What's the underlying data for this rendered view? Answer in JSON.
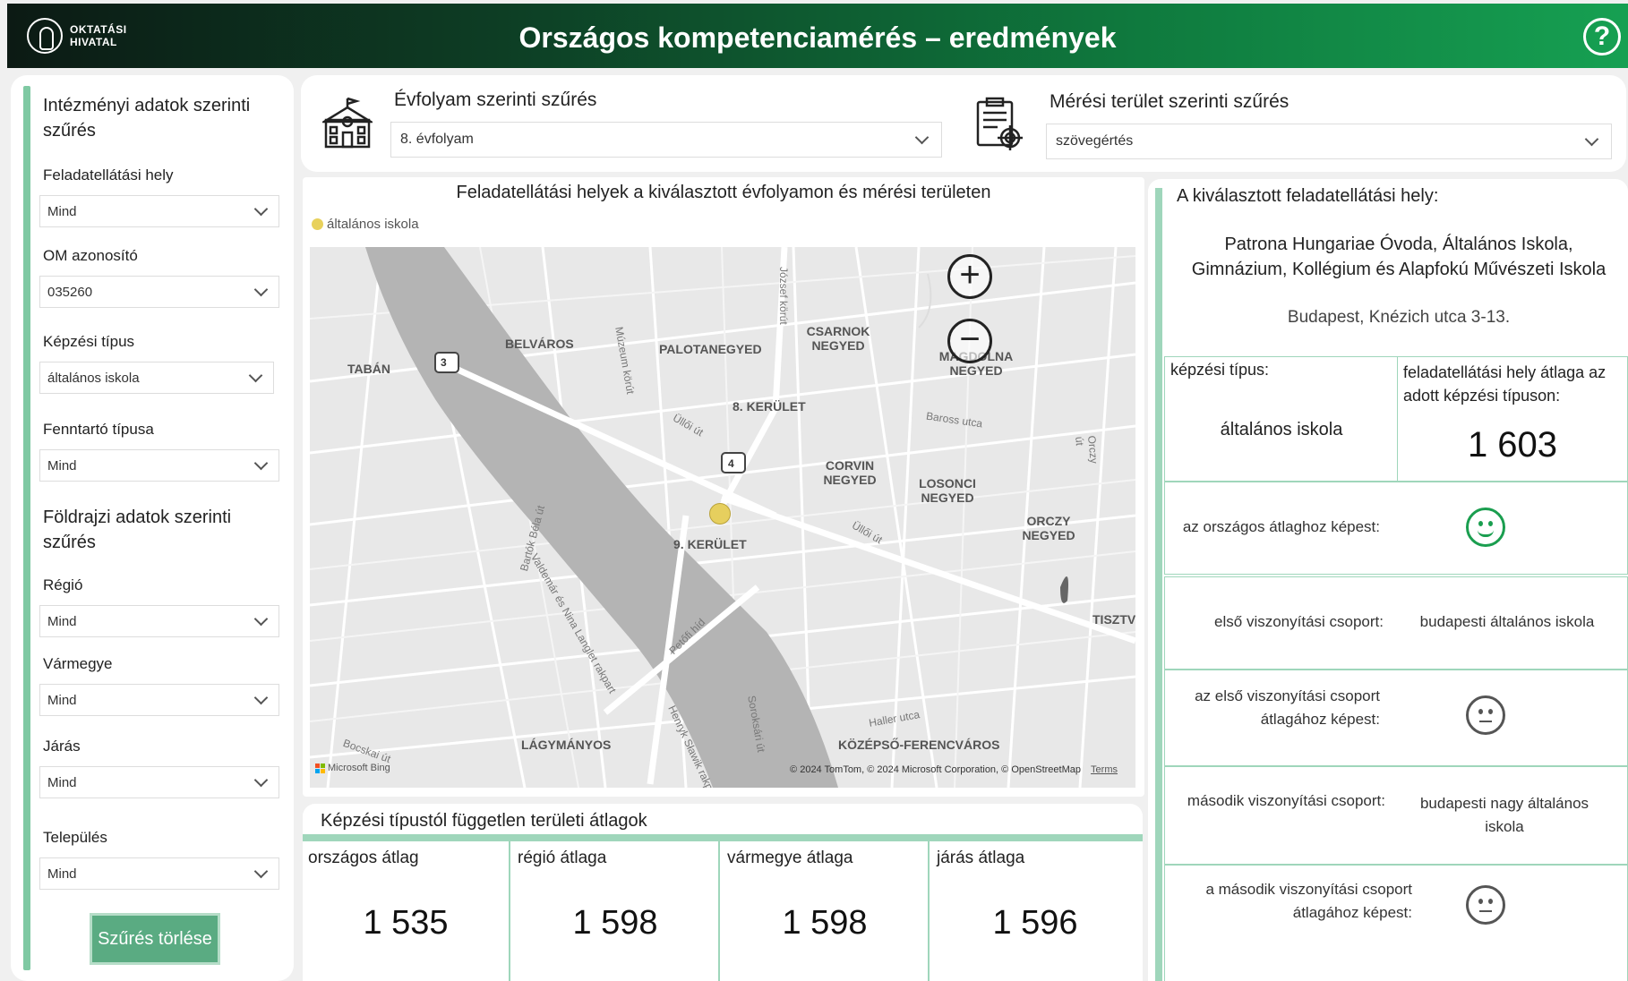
{
  "header": {
    "logo_line1": "OKTATÁSI",
    "logo_line2": "HIVATAL",
    "title": "Országos kompetenciamérés – eredmények",
    "help_label": "?"
  },
  "sidebar": {
    "heading_institution": "Intézményi adatok szerinti szűrés",
    "heading_geo": "Földrajzi adatok szerinti szűrés",
    "filters": [
      {
        "label": "Feladatellátási hely",
        "value": "Mind"
      },
      {
        "label": "OM azonosító",
        "value": "035260"
      },
      {
        "label": "Képzési típus",
        "value": "általános iskola"
      },
      {
        "label": "Fenntartó típusa",
        "value": "Mind"
      },
      {
        "label": "Régió",
        "value": "Mind"
      },
      {
        "label": "Vármegye",
        "value": "Mind"
      },
      {
        "label": "Járás",
        "value": "Mind"
      },
      {
        "label": "Település",
        "value": "Mind"
      }
    ],
    "clear_button": "Szűrés törlése"
  },
  "top_filters": {
    "grade_title": "Évfolyam szerinti szűrés",
    "grade_value": "8. évfolyam",
    "area_title": "Mérési terület szerinti szűrés",
    "area_value": "szövegértés"
  },
  "map": {
    "title": "Feladatellátási helyek a kiválasztott évfolyamon és mérési területen",
    "legend": "általános iskola",
    "legend_color": "#e8d15c",
    "labels": [
      "BELVÁROS",
      "PALOTANEGYED",
      "CSARNOK NEGYED",
      "MAGDOLNA NEGYED",
      "TABÁN",
      "8. KERÜLET",
      "CORVIN NEGYED",
      "LOSONCI NEGYED",
      "9. KERÜLET",
      "ORCZY NEGYED",
      "TISZTV",
      "LÁGYMÁNYOS",
      "KÖZÉPSŐ-FERENCVÁROS"
    ],
    "streets": [
      "Múzeum körút",
      "Üllői út",
      "József körút",
      "Baross utca",
      "Orczy út",
      "Vámház krt",
      "Petőfi híd",
      "Haller utca",
      "Soroksári út",
      "Henryk Sławik rakpart",
      "Bartók Béla út",
      "Bocskai út",
      "Valdemár és Nina Langlet rakpart"
    ],
    "route_badges": [
      "3",
      "4"
    ],
    "attribution": "© 2024 TomTom, © 2024 Microsoft Corporation, © OpenStreetMap",
    "terms": "Terms",
    "bing": "Microsoft Bing"
  },
  "averages": {
    "title": "Képzési típustól független területi átlagok",
    "items": [
      {
        "label": "országos átlag",
        "value": "1 535"
      },
      {
        "label": "régió átlaga",
        "value": "1 598"
      },
      {
        "label": "vármegye átlaga",
        "value": "1 598"
      },
      {
        "label": "járás átlaga",
        "value": "1 596"
      }
    ]
  },
  "selected": {
    "heading": "A kiválasztott feladatellátási hely:",
    "name_line1": "Patrona Hungariae Óvoda, Általános Iskola,",
    "name_line2": "Gimnázium, Kollégium és Alapfokú Művészeti Iskola",
    "address": "Budapest, Knézich utca 3-13.",
    "training_type_label": "képzési típus:",
    "training_type_value": "általános iskola",
    "avg_label": "feladatellátási hely átlaga az adott képzési típuson:",
    "avg_value": "1 603",
    "national_cmp_label": "az országos átlaghoz képest:",
    "group1_label": "első viszonyítási csoport:",
    "group1_value": "budapesti általános iskola",
    "group1_cmp_label": "az első viszonyítási csoport átlagához képest:",
    "group2_label": "második viszonyítási csoport:",
    "group2_value": "budapesti nagy általános iskola",
    "group2_cmp_label": "a második viszonyítási csoport átlagához képest:",
    "icons": {
      "national": "happy-face-icon",
      "group1": "neutral-face-icon",
      "group2": "neutral-face-icon"
    }
  }
}
